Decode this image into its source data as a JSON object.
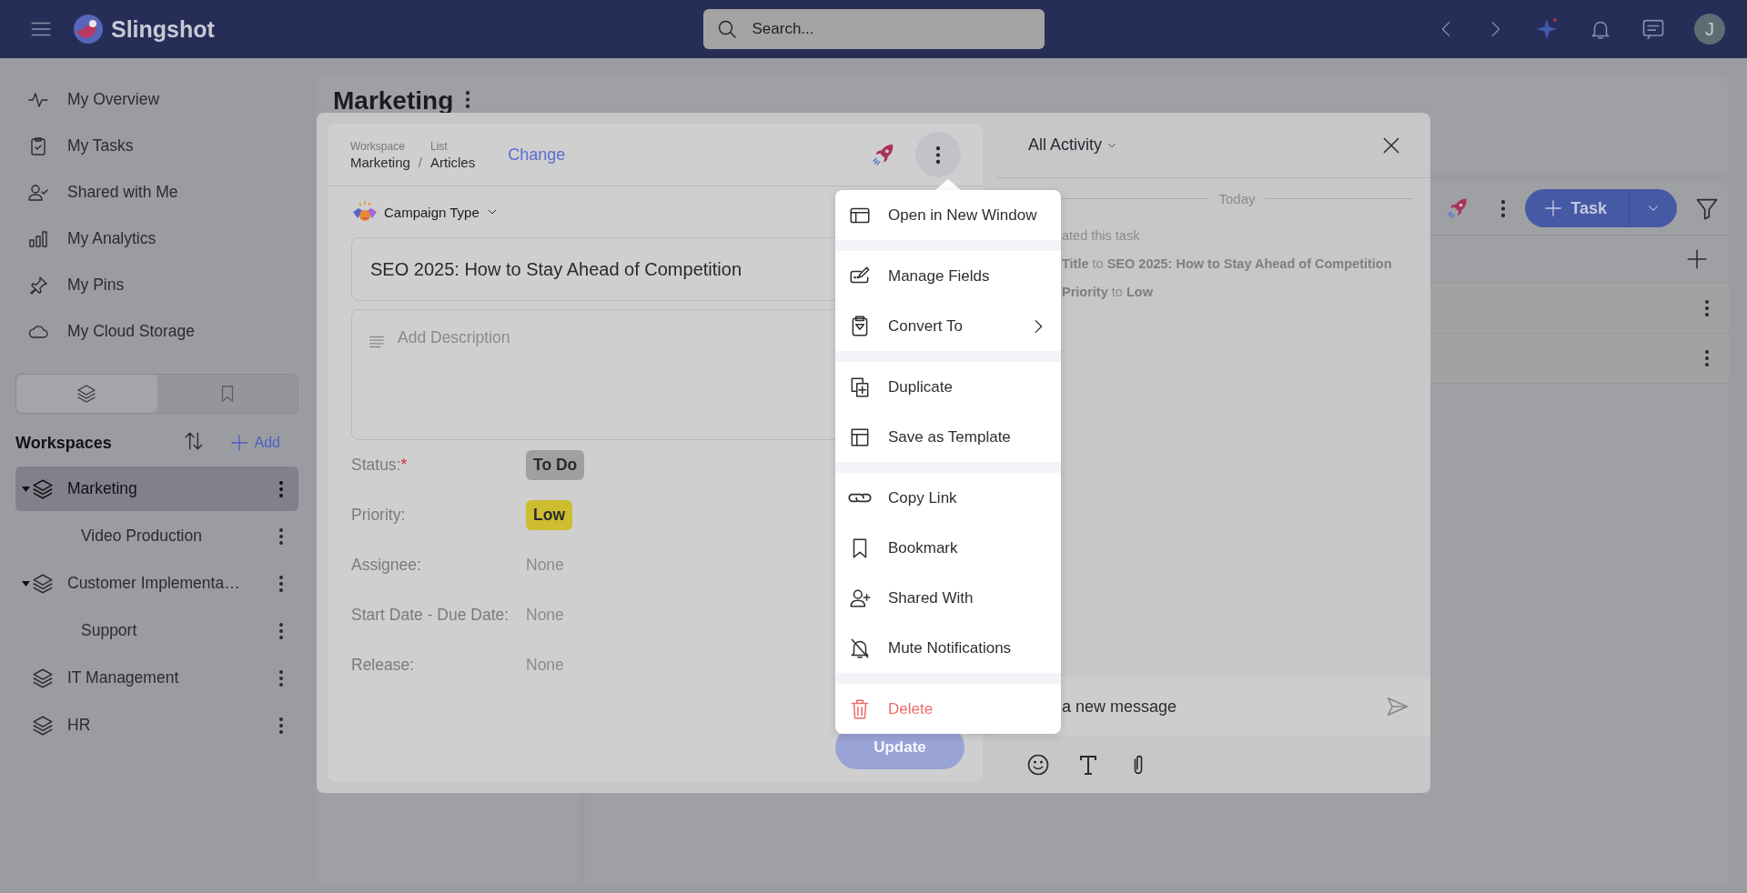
{
  "topbar": {
    "app_name": "Slingshot",
    "search": {
      "placeholder": "Search..."
    },
    "avatar": "J"
  },
  "sidebar": {
    "nav": [
      {
        "label": "My Overview"
      },
      {
        "label": "My Tasks"
      },
      {
        "label": "Shared with Me"
      },
      {
        "label": "My Analytics"
      },
      {
        "label": "My Pins"
      },
      {
        "label": "My Cloud Storage"
      }
    ],
    "view_tabs": [
      {
        "selected": true
      },
      {
        "selected": false
      }
    ],
    "workspaces_title": "Workspaces",
    "add_label": "Add",
    "workspaces": [
      {
        "name": "Marketing",
        "selected": true,
        "expanded": true,
        "children": [
          {
            "name": "Video Production",
            "selected": false
          }
        ]
      },
      {
        "name": "Customer Implementa…",
        "selected": false,
        "expanded": true,
        "children": [
          {
            "name": "Support",
            "selected": false
          }
        ]
      },
      {
        "name": "IT Management",
        "selected": false,
        "expanded": false
      },
      {
        "name": "HR",
        "selected": false,
        "expanded": false
      }
    ]
  },
  "page": {
    "title": "Marketing",
    "board": {
      "add_task_label": "Task"
    }
  },
  "task_dialog": {
    "breadcrumb": [
      {
        "label": "Workspace",
        "value": "Marketing"
      },
      {
        "label": "List",
        "value": "Articles"
      }
    ],
    "breadcrumb_separator": "/",
    "required_mark": "*",
    "change_link": "Change",
    "campaign_type": "Campaign Type",
    "title": "SEO 2025: How to Stay Ahead of Competition",
    "description": {
      "placeholder": "Add Description"
    },
    "fields": [
      {
        "label": "Status:",
        "required": true,
        "kind": "badge",
        "value": "To Do",
        "color": "#a0a0a0"
      },
      {
        "label": "Priority:",
        "kind": "badge",
        "value": "Low",
        "color": "#cdbd2f"
      },
      {
        "label": "Assignee:",
        "kind": "text",
        "value": "None"
      },
      {
        "label": "Start Date - Due Date:",
        "kind": "text",
        "value": "None"
      },
      {
        "label": "Release:",
        "kind": "text",
        "value": "None"
      }
    ],
    "update": {
      "label": "Update",
      "disabled": true
    }
  },
  "activity": {
    "filter": "All Activity",
    "divider": "Today",
    "entries": [
      "ated this task",
      "**Title** to **SEO 2025: How to Stay Ahead of Competition**",
      "**Priority** to **Low**"
    ],
    "message": {
      "placeholder": "a new message"
    }
  },
  "action_menu": {
    "groups": [
      {
        "items": [
          {
            "label": "Open in New Window",
            "kind": "plain"
          }
        ]
      },
      {
        "items": [
          {
            "label": "Manage Fields",
            "kind": "plain"
          },
          {
            "label": "Convert To",
            "kind": "submenu"
          }
        ]
      },
      {
        "items": [
          {
            "label": "Duplicate",
            "kind": "plain"
          },
          {
            "label": "Save as Template",
            "kind": "plain"
          }
        ]
      },
      {
        "items": [
          {
            "label": "Copy Link",
            "kind": "plain"
          },
          {
            "label": "Bookmark",
            "kind": "plain"
          },
          {
            "label": "Shared With",
            "kind": "plain"
          },
          {
            "label": "Mute Notifications",
            "kind": "plain"
          }
        ]
      },
      {
        "items": [
          {
            "label": "Delete",
            "kind": "danger"
          }
        ]
      }
    ]
  }
}
